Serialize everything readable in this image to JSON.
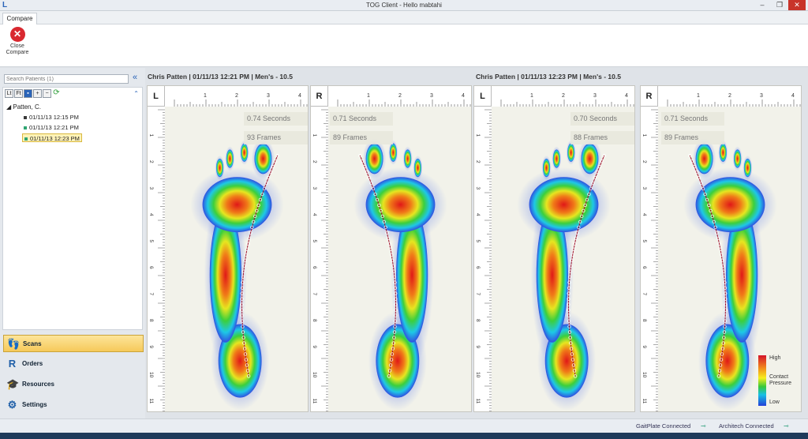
{
  "window": {
    "title": "TOG Client - Hello mabtahi"
  },
  "ribbon": {
    "tab": "Compare",
    "close_line1": "Close",
    "close_line2": "Compare"
  },
  "sidebar": {
    "search_placeholder": "Search Patients (1)",
    "patient": "Patten, C.",
    "scans": [
      {
        "label": "01/11/13 12:15 PM",
        "color": "#3a3a3a"
      },
      {
        "label": "01/11/13 12:21 PM",
        "color": "#2fa572"
      },
      {
        "label": "01/11/13 12:23 PM",
        "color": "#2fa572"
      }
    ],
    "selected_scan": 2,
    "nav": [
      {
        "label": "Scans",
        "icon": "footprint-icon"
      },
      {
        "label": "Orders",
        "icon": "orders-icon"
      },
      {
        "label": "Resources",
        "icon": "graduation-cap-icon"
      },
      {
        "label": "Settings",
        "icon": "gear-icon"
      }
    ]
  },
  "comparisons": [
    {
      "header": "Chris Patten | 01/11/13 12:21 PM | Men's - 10.5",
      "left": {
        "side": "L",
        "time": "0.74 Seconds",
        "frames": "93 Frames"
      },
      "right": {
        "side": "R",
        "time": "0.71 Seconds",
        "frames": "89 Frames"
      }
    },
    {
      "header": "Chris Patten | 01/11/13 12:23 PM | Men's - 10.5",
      "left": {
        "side": "L",
        "time": "0.70 Seconds",
        "frames": "88 Frames"
      },
      "right": {
        "side": "R",
        "time": "0.71 Seconds",
        "frames": "89 Frames"
      }
    }
  ],
  "ruler": {
    "top_ticks": [
      "1",
      "2",
      "3",
      "4"
    ],
    "side_ticks": [
      "1",
      "2",
      "3",
      "4",
      "5",
      "6",
      "7",
      "8",
      "9",
      "10",
      "11"
    ]
  },
  "legend": {
    "high": "High",
    "title1": "Contact",
    "title2": "Pressure",
    "low": "Low"
  },
  "status": {
    "gaitplate": "GaitPlate Connected",
    "architech": "Architech Connected"
  }
}
